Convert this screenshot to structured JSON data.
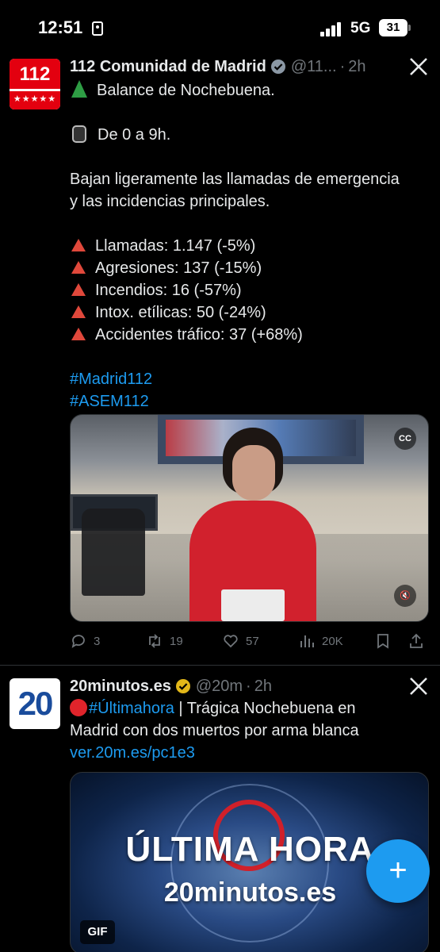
{
  "status_bar": {
    "time": "12:51",
    "network": "5G",
    "battery": "31"
  },
  "tweets": [
    {
      "author": "112 Comunidad de Madrid",
      "handle": "@11...",
      "age": "2h",
      "avatar_text": "112",
      "avatar_stars": "★★★★★",
      "lines": [
        "Balance de Nochebuena.",
        "De 0 a 9h.",
        "Bajan ligeramente las llamadas de emergencia",
        "y las incidencias principales.",
        "Llamadas: 1.147 (-5%)",
        "Agresiones: 137 (-15%)",
        "Incendios: 16 (-57%)",
        "Intox. etílicas: 50 (-24%)",
        "Accidentes tráfico: 37 (+68%)"
      ],
      "hashtags": [
        "#Madrid112",
        "#ASEM112"
      ],
      "video_cc": "CC",
      "video_mute": "🔇",
      "actions": {
        "replies": "3",
        "reposts": "19",
        "likes": "57",
        "views": "20K"
      }
    },
    {
      "author": "20minutos.es",
      "handle": "@20m",
      "age": "2h",
      "avatar_text": "20",
      "hashtag": "#Últimahora",
      "text_after_hashtag": " | Trágica Nochebuena en",
      "text_line2": "Madrid con dos muertos por arma blanca",
      "link": "ver.20m.es/pc1e3",
      "gif_line1": "ÚLTIMA HORA",
      "gif_line2": "20minutos.es",
      "gif_label": "GIF"
    }
  ],
  "fab_label": "+",
  "colors": {
    "accent": "#1d9bf0",
    "verified": "#e2b719",
    "background": "#000000"
  }
}
